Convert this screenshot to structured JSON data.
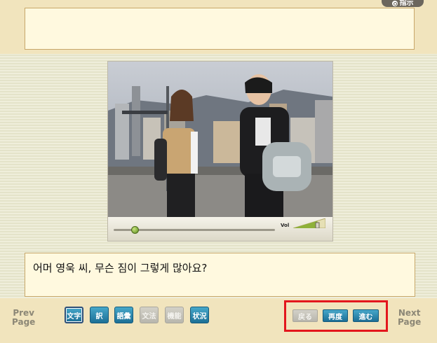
{
  "header": {
    "hint_label": "指示"
  },
  "player": {
    "volume_label": "Vol",
    "playback_progress": 0.13,
    "volume_level": 0.75
  },
  "subtitle": {
    "text": "어머 영욱 씨, 무슨 짐이 그렇게 많아요?"
  },
  "footer": {
    "prev_page": [
      "Prev",
      "Page"
    ],
    "next_page": [
      "Next",
      "Page"
    ],
    "mode_buttons": [
      {
        "label": "文字",
        "state": "active"
      },
      {
        "label": "訳",
        "state": "on"
      },
      {
        "label": "語彙",
        "state": "on"
      },
      {
        "label": "文法",
        "state": "off"
      },
      {
        "label": "機能",
        "state": "off"
      },
      {
        "label": "状況",
        "state": "on"
      }
    ],
    "nav_buttons": [
      {
        "label": "戻る",
        "state": "off"
      },
      {
        "label": "再度",
        "state": "on"
      },
      {
        "label": "進む",
        "state": "on"
      }
    ]
  },
  "colors": {
    "accent_blue": "#1c6f96",
    "highlight_red": "#e3161d",
    "panel_bg": "#fff9df"
  }
}
